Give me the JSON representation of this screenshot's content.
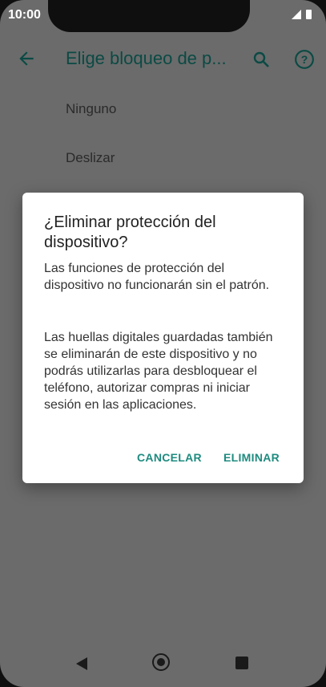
{
  "status_bar": {
    "time": "10:00",
    "signal_icon": "signal-icon",
    "battery_icon": "battery-icon"
  },
  "app_bar": {
    "title": "Elige bloqueo de p...",
    "back_icon": "arrow-back-icon",
    "search_icon": "search-icon",
    "help_icon": "help-circle-icon",
    "title_color": "#0b4a44"
  },
  "list": {
    "items": [
      {
        "label": "Ninguno"
      },
      {
        "label": "Deslizar"
      }
    ]
  },
  "dialog": {
    "title": "¿Eliminar protección del dispositivo?",
    "body1": "Las funciones de protección del dispositivo no funcionarán sin el patrón.",
    "body2": "Las huellas digitales guardadas también se eliminarán de este dispositivo y no podrás utilizarlas para desbloquear el teléfono, autorizar compras ni iniciar sesión en las aplicaciones.",
    "cancel_label": "CANCELAR",
    "confirm_label": "ELIMINAR",
    "accent_color": "#1e8b7f"
  },
  "nav_bar": {
    "back_icon": "back-triangle-icon",
    "home_icon": "home-circle-icon",
    "recents_icon": "recents-square-icon"
  }
}
